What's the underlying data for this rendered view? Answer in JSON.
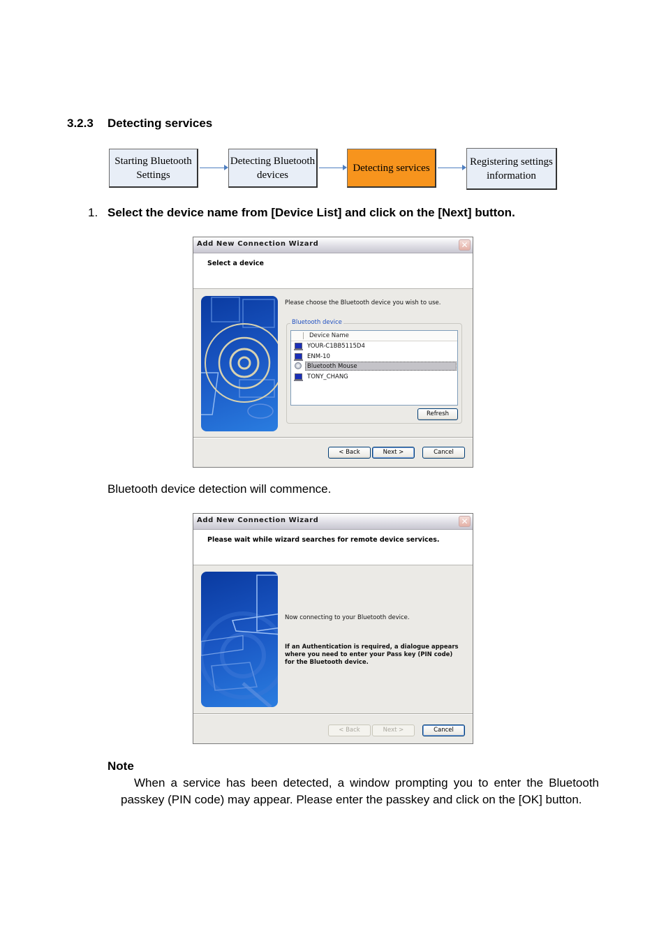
{
  "section": {
    "number": "3.2.3",
    "title": "Detecting services"
  },
  "flow": {
    "steps": [
      {
        "label": "Starting Bluetooth Settings",
        "active": false
      },
      {
        "label": "Detecting Bluetooth devices",
        "active": false
      },
      {
        "label": "Detecting services",
        "active": true
      },
      {
        "label": "Registering settings information",
        "active": false
      }
    ],
    "active_color": "#f7941d"
  },
  "step1": {
    "number": "1.",
    "text": "Select the device name from [Device List] and click on the [Next] button."
  },
  "wizard1": {
    "title": "Add New Connection Wizard",
    "header": "Select a device",
    "instruction": "Please choose the Bluetooth device you wish to use.",
    "group_label": "Bluetooth device",
    "column_header": "Device Name",
    "devices": [
      {
        "name": "YOUR-C1BB5115D4",
        "icon": "computer-icon",
        "selected": false
      },
      {
        "name": "ENM-10",
        "icon": "computer-icon",
        "selected": false
      },
      {
        "name": "Bluetooth Mouse",
        "icon": "mouse-icon",
        "selected": true
      },
      {
        "name": "TONY_CHANG",
        "icon": "computer-icon",
        "selected": false
      }
    ],
    "refresh_label": "Refresh",
    "back_label": "< Back",
    "next_label": "Next >",
    "cancel_label": "Cancel"
  },
  "para1": "Bluetooth device detection will commence.",
  "wizard2": {
    "title": "Add New Connection Wizard",
    "header": "Please wait while wizard searches for remote device services.",
    "status": "Now connecting to your Bluetooth device.",
    "auth_note": "If an Authentication is required, a dialogue appears where you need to enter your Pass key (PIN code) for the Bluetooth device.",
    "back_label": "< Back",
    "next_label": "Next >",
    "cancel_label": "Cancel"
  },
  "note": {
    "title": "Note",
    "body": "When a service has been detected, a window prompting you to enter the Bluetooth passkey (PIN code) may appear. Please enter the passkey and click on the [OK] button."
  }
}
